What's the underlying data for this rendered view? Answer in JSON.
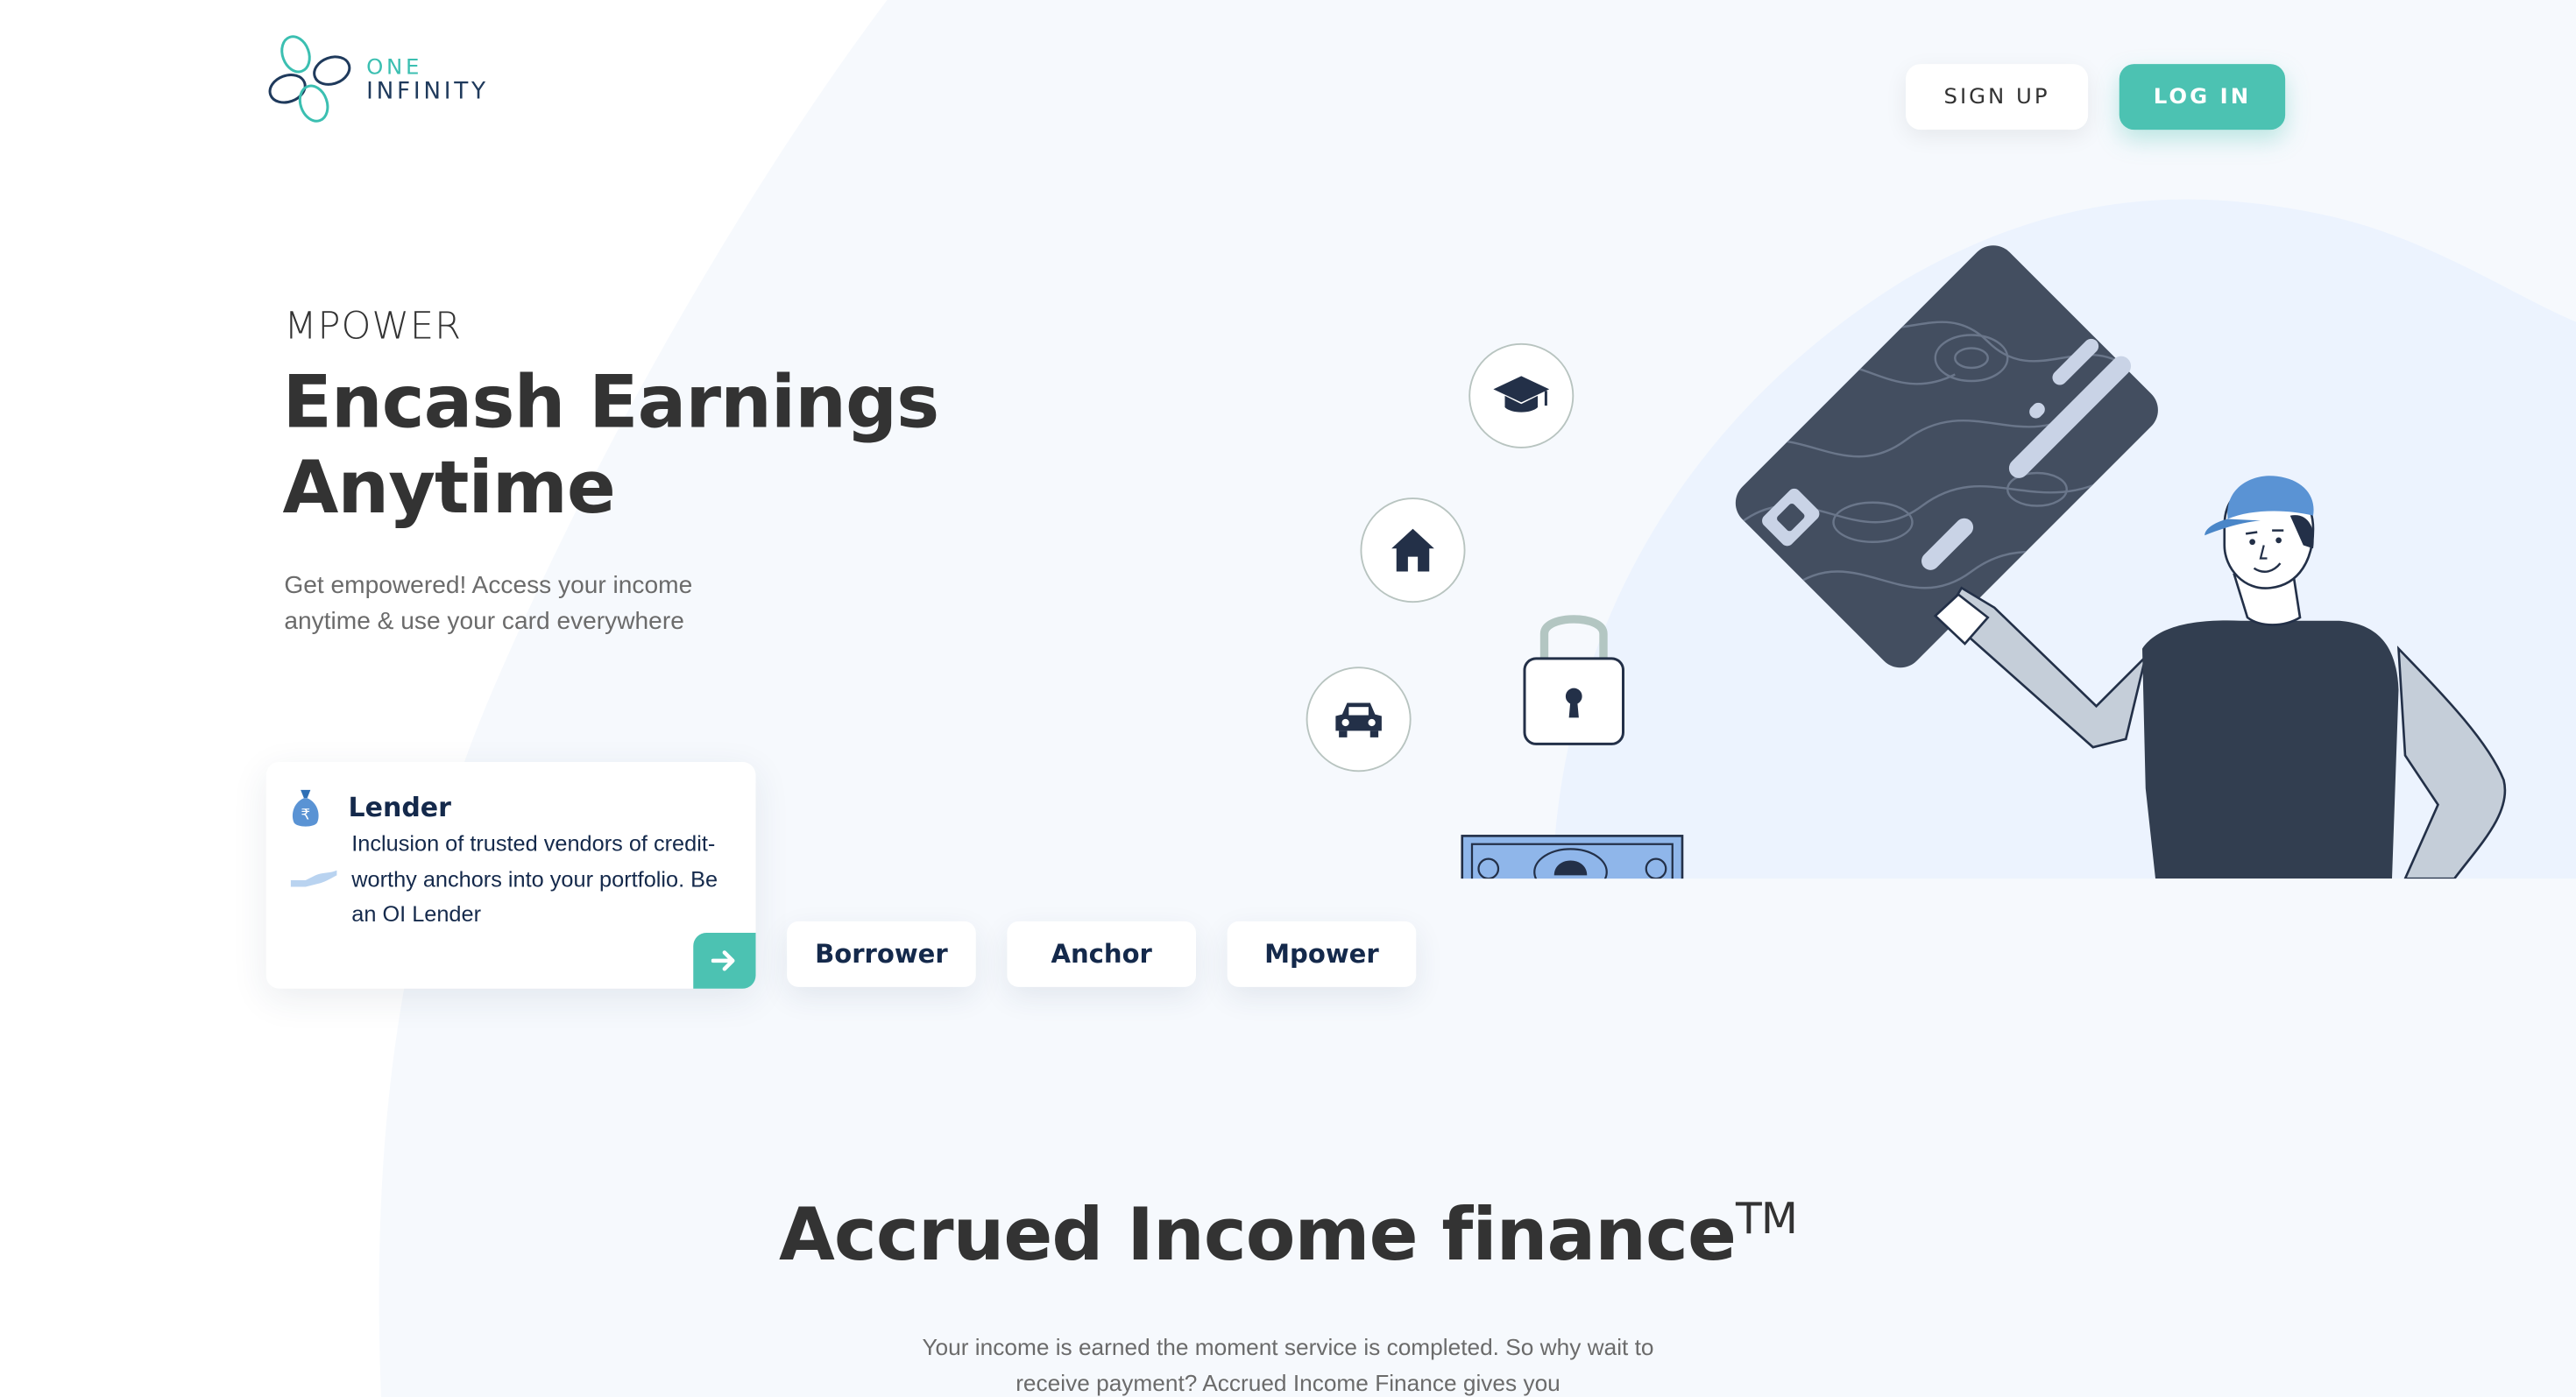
{
  "brand": {
    "line1": "ONE",
    "line2": "INFINITY"
  },
  "header": {
    "signup_label": "SIGN UP",
    "login_label": "LOG IN"
  },
  "hero": {
    "eyebrow": "MPOWER",
    "title_line1": "Encash Earnings",
    "title_line2": "Anytime",
    "subtitle": "Get empowered! Access your income anytime & use your card everywhere"
  },
  "lender_card": {
    "title": "Lender",
    "description": "Inclusion of trusted vendors of credit-worthy anchors into your portfolio. Be an OI Lender",
    "icon": "money-bag-icon",
    "arrow_icon": "arrow-right-icon"
  },
  "tabs": [
    {
      "label": "Borrower"
    },
    {
      "label": "Anchor"
    },
    {
      "label": "Mpower"
    }
  ],
  "illustration": {
    "icons": [
      "graduation-cap-icon",
      "house-icon",
      "car-icon",
      "padlock-icon",
      "credit-card",
      "banknote"
    ]
  },
  "section2": {
    "title": "Accrued Income finance",
    "trademark": "TM",
    "body": "Your income is earned the moment service is completed. So why wait to receive payment? Accrued Income Finance gives you"
  },
  "colors": {
    "accent": "#4cc2b2",
    "navy": "#14294b",
    "card_dark": "#3b4657",
    "light_blue_bg": "#ecf3fe"
  }
}
